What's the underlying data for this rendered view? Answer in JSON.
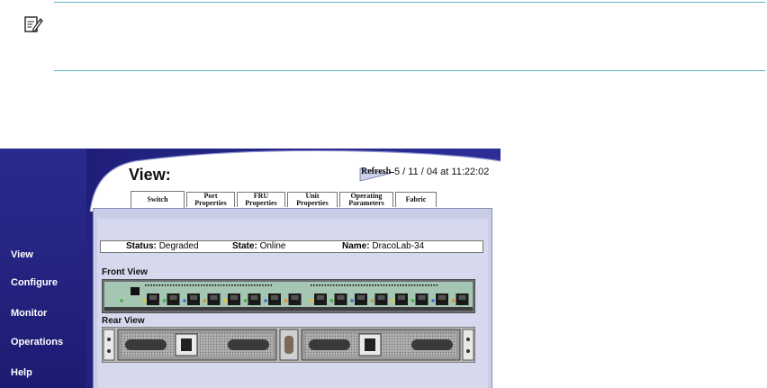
{
  "sidebar": {
    "items": [
      {
        "label": "View"
      },
      {
        "label": "Configure"
      },
      {
        "label": "Monitor"
      },
      {
        "label": "Operations"
      },
      {
        "label": "Help"
      }
    ]
  },
  "header": {
    "title": "View:",
    "refresh_label": "Refresh",
    "refresh_date": "5 / 11 / 04 at 11:22:02"
  },
  "tabs": [
    {
      "line1": "Switch",
      "line2": ""
    },
    {
      "line1": "Port",
      "line2": "Properties"
    },
    {
      "line1": "FRU",
      "line2": "Properties"
    },
    {
      "line1": "Unit",
      "line2": "Properties"
    },
    {
      "line1": "Operating",
      "line2": "Parameters"
    },
    {
      "line1": "Fabric",
      "line2": ""
    }
  ],
  "status": {
    "status_label": "Status:",
    "status_value": "Degraded",
    "state_label": "State:",
    "state_value": "Online",
    "name_label": "Name:",
    "name_value": "DracoLab-34"
  },
  "sections": {
    "front": "Front View",
    "rear": "Rear View"
  },
  "colors": {
    "sidebar": "#23237f",
    "accent_rule": "#5fb3c4",
    "panel": "#c9cde6"
  },
  "icons": {
    "note": "note-pencil-icon"
  }
}
